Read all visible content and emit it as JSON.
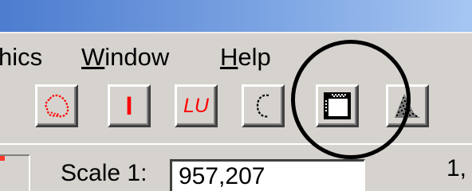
{
  "menubar": {
    "items": [
      {
        "label": "hics",
        "mnemonic_before": "",
        "mnemonic": "",
        "rest": "hics"
      },
      {
        "label": "Window",
        "mnemonic": "W",
        "rest": "indow"
      },
      {
        "label": "Help",
        "mnemonic": "H",
        "rest": "elp"
      }
    ]
  },
  "toolbar": {
    "buttons": [
      {
        "name": "lasso-select",
        "icon": "lasso-icon",
        "label": ""
      },
      {
        "name": "i-tool",
        "icon": "i-icon",
        "label": "I"
      },
      {
        "name": "lu-tool",
        "icon": "lu-icon",
        "label": "LU"
      },
      {
        "name": "c-tool",
        "icon": "c-icon",
        "label": "C"
      },
      {
        "name": "window-tool",
        "icon": "window-icon",
        "label": ""
      },
      {
        "name": "density-tool",
        "icon": "density-icon",
        "label": ""
      }
    ]
  },
  "statusbar": {
    "scale_label": "Scale 1:",
    "scale_value": "957,207",
    "right_text": "1,"
  },
  "colors": {
    "titlebar_start": "#4d7ccf",
    "titlebar_end": "#a6c6f2",
    "face": "#d6d3ce",
    "accent_red": "#ff0000"
  }
}
